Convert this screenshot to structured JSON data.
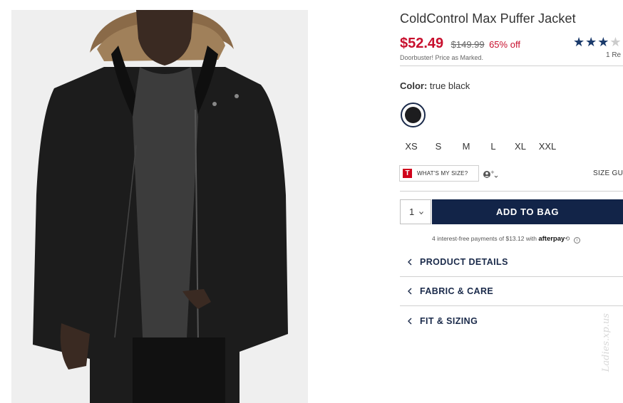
{
  "product": {
    "title": "ColdControl Max Puffer Jacket",
    "price_now": "$52.49",
    "price_was": "$149.99",
    "discount": "65% off",
    "note": "Doorbuster! Price as Marked.",
    "rating_stars_filled": 3,
    "rating_stars_total": 4,
    "reviews": "1 Re"
  },
  "color": {
    "label": "Color:",
    "value": "true black",
    "swatch_hex": "#1d1d1f"
  },
  "sizes": [
    "XS",
    "S",
    "M",
    "L",
    "XL",
    "XXL"
  ],
  "size_tools": {
    "whats_my_size": "WHAT'S MY SIZE?",
    "badge_letter": "T",
    "size_guide": "SIZE GU"
  },
  "purchase": {
    "quantity": "1",
    "add_to_bag": "ADD TO BAG",
    "afterpay_text": "4 interest-free payments of $13.12 with",
    "afterpay_brand": "afterpay"
  },
  "accordions": [
    {
      "label": "PRODUCT DETAILS"
    },
    {
      "label": "FABRIC & CARE"
    },
    {
      "label": "FIT & SIZING"
    }
  ],
  "watermark": "Ladies.xp.us",
  "colors": {
    "sale_red": "#c8102e",
    "navy": "#122448",
    "star_blue": "#1a3a6b"
  }
}
